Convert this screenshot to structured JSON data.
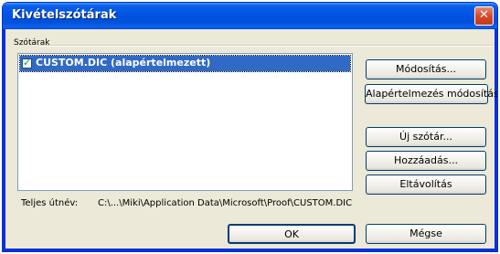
{
  "window": {
    "title": "Kivételszótárak",
    "close_glyph": "✕"
  },
  "group": {
    "label": "Szótárak"
  },
  "list": {
    "items": [
      {
        "label": "CUSTOM.DIC (alapértelmezett)",
        "checked": true,
        "selected": true
      }
    ]
  },
  "buttons": {
    "modify": "Módosítás...",
    "default_modify": "Alapértelmezés módosítása",
    "new_dictionary": "Új szótár...",
    "add": "Hozzáadás...",
    "remove": "Eltávolítás",
    "ok": "OK",
    "cancel": "Mégse"
  },
  "path": {
    "label": "Teljes útnév:",
    "value": "C:\\...\\Miki\\Application Data\\Microsoft\\Proof\\CUSTOM.DIC"
  },
  "colors": {
    "titlebar": "#0054e3",
    "selection": "#316ac5",
    "dialog_bg": "#ece9d8",
    "close_button": "#d8492a"
  }
}
